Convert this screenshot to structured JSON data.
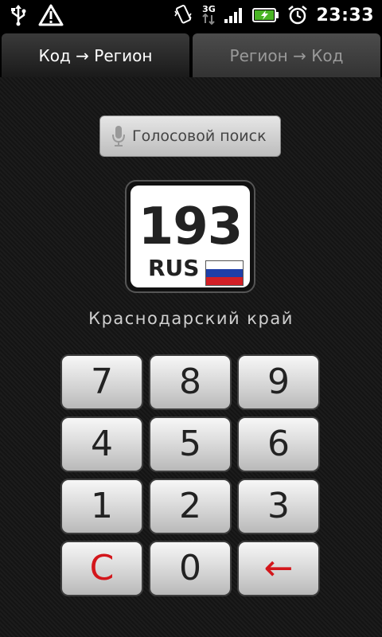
{
  "status_bar": {
    "time": "23:33",
    "network": "3G",
    "icons": [
      "usb-icon",
      "warning-icon",
      "vibrate-icon",
      "network-3g-icon",
      "signal-icon",
      "battery-charging-icon",
      "alarm-icon"
    ]
  },
  "tabs": [
    {
      "label": "Код → Регион",
      "active": true
    },
    {
      "label": "Регион → Код",
      "active": false
    }
  ],
  "voice_search": {
    "label": "Голосовой поиск",
    "icon": "microphone-icon"
  },
  "plate": {
    "code": "193",
    "country": "RUS"
  },
  "region_name": "Краснодарский край",
  "keypad": {
    "keys": [
      "7",
      "8",
      "9",
      "4",
      "5",
      "6",
      "1",
      "2",
      "3",
      "C",
      "0",
      "←"
    ]
  },
  "colors": {
    "accent_red": "#d3161b",
    "flag_white": "#ffffff",
    "flag_blue": "#1f3fa8",
    "flag_red": "#d21f26"
  }
}
